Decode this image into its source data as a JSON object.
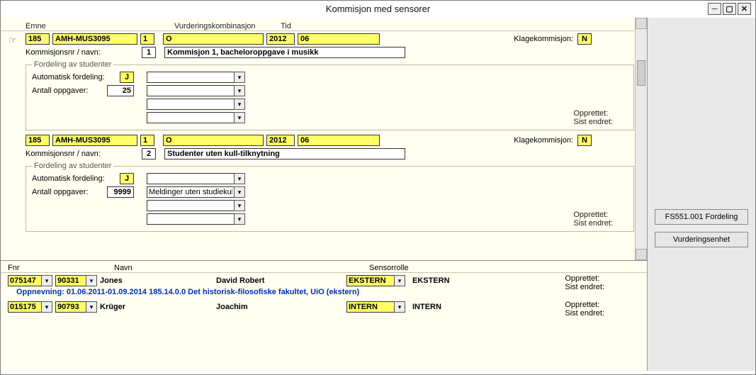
{
  "window": {
    "title": "Kommisjon med sensorer"
  },
  "headers": {
    "emne": "Emne",
    "vkomb": "Vurderingskombinasjon",
    "tid": "Tid"
  },
  "labels": {
    "klagekommisjon": "Klagekommisjon:",
    "komm_nr": "Kommisjonsnr / navn:",
    "fordeling_legend": "Fordeling av studenter",
    "auto": "Automatisk fordeling:",
    "antall": "Antall oppgaver:",
    "opprettet": "Opprettet:",
    "sist_endret": "Sist endret:"
  },
  "buttons": {
    "fs": "FS551.001 Fordeling",
    "vurd": "Vurderingsenhet"
  },
  "komm": [
    {
      "pointer": true,
      "emne1": "185",
      "emne2": "AMH-MUS3095",
      "emne3": "1",
      "vkomb": "O",
      "aar": "2012",
      "mnd": "06",
      "klage": "N",
      "nr": "1",
      "navn": "Kommisjon 1, bacheloroppgave i musikk",
      "auto": "J",
      "antall": "25",
      "slots": [
        "",
        "",
        "",
        ""
      ]
    },
    {
      "pointer": false,
      "emne1": "185",
      "emne2": "AMH-MUS3095",
      "emne3": "1",
      "vkomb": "O",
      "aar": "2012",
      "mnd": "06",
      "klage": "N",
      "nr": "2",
      "navn": "Studenter uten kull-tilknytning",
      "auto": "J",
      "antall": "9999",
      "slots": [
        "",
        "Meldinger uten studiekull",
        "",
        ""
      ]
    }
  ],
  "lower": {
    "headers": {
      "fnr": "Fnr",
      "navn": "Navn",
      "rolle": "Sensorrolle"
    },
    "rows": [
      {
        "fnr1": "075147",
        "fnr2": "90331",
        "etternavn": "Jones",
        "fornavn": "David Robert",
        "rolle_kode": "EKSTERN",
        "rolle_txt": "EKSTERN",
        "appoint": "Oppnevning: 01.06.2011-01.09.2014 185.14.0.0 Det historisk-filosofiske fakultet, UiO (ekstern)"
      },
      {
        "fnr1": "015175",
        "fnr2": "90793",
        "etternavn": "Krüger",
        "fornavn": "Joachim",
        "rolle_kode": "INTERN",
        "rolle_txt": "INTERN",
        "appoint": ""
      }
    ]
  }
}
